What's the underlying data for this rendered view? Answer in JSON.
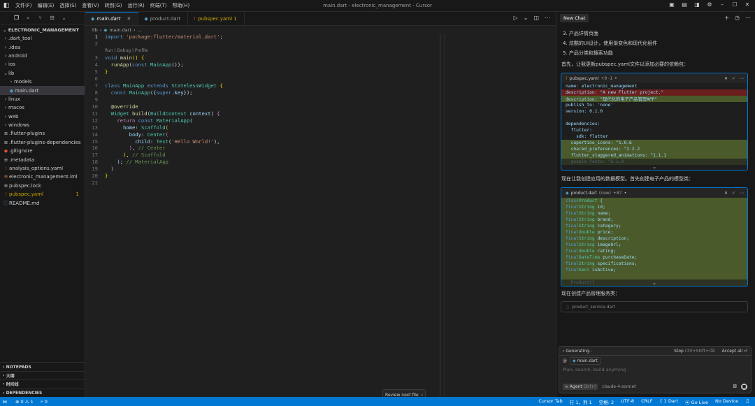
{
  "titlebar": {
    "menu": [
      "文件(F)",
      "编辑(E)",
      "选择(S)",
      "查看(V)",
      "转到(G)",
      "运行(R)",
      "终端(T)",
      "帮助(H)"
    ],
    "window_title": "main.dart - electronic_management - Cursor"
  },
  "explorer": {
    "project": "ELECTRONIC_MANAGEMENT",
    "items": [
      {
        "name": ".dart_tool",
        "type": "folder",
        "depth": 0
      },
      {
        "name": ".idea",
        "type": "folder",
        "depth": 0
      },
      {
        "name": "android",
        "type": "folder",
        "depth": 0
      },
      {
        "name": "ios",
        "type": "folder",
        "depth": 0
      },
      {
        "name": "lib",
        "type": "folder-open",
        "depth": 0
      },
      {
        "name": "models",
        "type": "folder",
        "depth": 1
      },
      {
        "name": "main.dart",
        "type": "dart",
        "depth": 1
      },
      {
        "name": "linux",
        "type": "folder",
        "depth": 0
      },
      {
        "name": "macos",
        "type": "folder",
        "depth": 0
      },
      {
        "name": "web",
        "type": "folder",
        "depth": 0
      },
      {
        "name": "windows",
        "type": "folder",
        "depth": 0
      },
      {
        "name": ".flutter-plugins",
        "type": "file",
        "depth": 0
      },
      {
        "name": ".flutter-plugins-dependencies",
        "type": "file",
        "depth": 0
      },
      {
        "name": ".gitignore",
        "type": "git",
        "depth": 0
      },
      {
        "name": ".metadata",
        "type": "file",
        "depth": 0
      },
      {
        "name": "analysis_options.yaml",
        "type": "yaml",
        "depth": 0
      },
      {
        "name": "electronic_management.iml",
        "type": "iml",
        "depth": 0
      },
      {
        "name": "pubspec.lock",
        "type": "file",
        "depth": 0
      },
      {
        "name": "pubspec.yaml",
        "type": "yaml-warn",
        "depth": 0,
        "badge": "1"
      },
      {
        "name": "README.md",
        "type": "info",
        "depth": 0
      }
    ],
    "panels": [
      "NOTEPADS",
      "大纲",
      "时间线",
      "DEPENDENCIES"
    ]
  },
  "editor": {
    "tabs": [
      {
        "label": "main.dart",
        "active": true
      },
      {
        "label": "product.dart",
        "active": false
      },
      {
        "label": "pubspec.yaml 1",
        "active": false,
        "warn": true
      }
    ],
    "breadcrumb": [
      "lib",
      "main.dart",
      "..."
    ],
    "codelens": "Run | Debug | Profile",
    "lines": [
      {
        "n": "1",
        "html": "<span class=\"k\">import</span> <span class=\"s\">'package:flutter/material.dart'</span>;"
      },
      {
        "n": "2",
        "html": ""
      },
      {
        "n": "3",
        "html": "<span class=\"k\">void</span> <span class=\"f\">main</span><span class=\"y\">()</span> <span class=\"y\">{</span>"
      },
      {
        "n": "4",
        "html": "  <span class=\"f\">runApp</span>(<span class=\"k\">const</span> <span class=\"t\">MainApp</span>());"
      },
      {
        "n": "5",
        "html": "<span class=\"y\">}</span>"
      },
      {
        "n": "6",
        "html": ""
      },
      {
        "n": "7",
        "html": "<span class=\"k\">class</span> <span class=\"t\">MainApp</span> <span class=\"k\">extends</span> <span class=\"t\">StatelessWidget</span> <span class=\"y\">{</span>"
      },
      {
        "n": "8",
        "html": "  <span class=\"k\">const</span> <span class=\"t\">MainApp</span>(<span class=\"p\">{</span><span class=\"k\">super</span>.<span class=\"p\">key</span><span class=\"p\">}</span>);"
      },
      {
        "n": "9",
        "html": ""
      },
      {
        "n": "10",
        "html": "  <span class=\"an\">@override</span>"
      },
      {
        "n": "11",
        "html": "  <span class=\"t\">Widget</span> <span class=\"f\">build</span>(<span class=\"t\">BuildContext</span> <span class=\"p\">context</span>) <span class=\"kw\">{</span>"
      },
      {
        "n": "12",
        "html": "    <span class=\"kw\">return</span> <span class=\"k\">const</span> <span class=\"t\">MaterialApp</span><span class=\"p\">(</span>"
      },
      {
        "n": "13",
        "html": "      <span class=\"p\">home</span>: <span class=\"t\">Scaffold</span><span class=\"y\">(</span>"
      },
      {
        "n": "14",
        "html": "        <span class=\"p\">body</span>: <span class=\"t\">Center</span><span class=\"kw\">(</span>"
      },
      {
        "n": "15",
        "html": "          <span class=\"p\">child</span>: <span class=\"t\">Text</span>(<span class=\"s\">'Hello World!'</span>),"
      },
      {
        "n": "16",
        "html": "        <span class=\"kw\">)</span>, <span class=\"c\">// Center</span>"
      },
      {
        "n": "17",
        "html": "      <span class=\"y\">)</span>, <span class=\"c\">// Scaffold</span>"
      },
      {
        "n": "18",
        "html": "    <span class=\"p\">)</span>; <span class=\"c\">// MaterialApp</span>"
      },
      {
        "n": "19",
        "html": "  <span class=\"kw\">}</span>"
      },
      {
        "n": "20",
        "html": "<span class=\"y\">}</span>"
      },
      {
        "n": "21",
        "html": ""
      }
    ],
    "review_label": "Review next file"
  },
  "chat": {
    "new_chat": "New Chat",
    "list_items": [
      "3. 产品详情页面",
      "4. 炫酷的UI设计，使用渐变色和现代化组件",
      "5. 产品分类和搜索功能"
    ],
    "para1": "首先，让我更新pubspec.yaml文件以添加必要的依赖包：",
    "block1": {
      "file": "pubspec.yaml",
      "diff": "+9 -1",
      "lines": [
        {
          "t": "name: electronic_management",
          "k": ""
        },
        {
          "t": "description: \"A new Flutter project.\"",
          "k": "del"
        },
        {
          "t": "description: \"现代化的电子产品管理APP\"",
          "k": "add"
        },
        {
          "t": "publish_to: 'none'",
          "k": ""
        },
        {
          "t": "version: 0.1.0",
          "k": ""
        },
        {
          "t": "",
          "k": ""
        },
        {
          "t": "dependencies:",
          "k": ""
        },
        {
          "t": "  flutter:",
          "k": ""
        },
        {
          "t": "    sdk: flutter",
          "k": ""
        },
        {
          "t": "  cupertino_icons: ^1.0.6",
          "k": "add"
        },
        {
          "t": "  shared_preferences: ^2.2.2",
          "k": "add"
        },
        {
          "t": "  flutter_staggered_animations: ^1.1.1",
          "k": "add"
        },
        {
          "t": "  google_fonts: ^6.1.0",
          "k": "add fade"
        }
      ]
    },
    "para2": "现在让我创建应用的数据模型。首先创建电子产品的模型类：",
    "block2": {
      "file": "product.dart",
      "tag": "(new)",
      "diff": "+87",
      "lines": [
        {
          "t": "class Product {",
          "k": "add"
        },
        {
          "t": "  final String id;",
          "k": "add"
        },
        {
          "t": "  final String name;",
          "k": "add"
        },
        {
          "t": "  final String brand;",
          "k": "add"
        },
        {
          "t": "  final String category;",
          "k": "add"
        },
        {
          "t": "  final double price;",
          "k": "add"
        },
        {
          "t": "  final String description;",
          "k": "add"
        },
        {
          "t": "  final String imageUrl;",
          "k": "add"
        },
        {
          "t": "  final double rating;",
          "k": "add"
        },
        {
          "t": "  final DateTime purchaseDate;",
          "k": "add"
        },
        {
          "t": "  final String specifications;",
          "k": "add"
        },
        {
          "t": "  final bool isActive;",
          "k": "add"
        },
        {
          "t": "",
          "k": "add"
        },
        {
          "t": "  Product({",
          "k": "add fade"
        }
      ]
    },
    "para3": "现在创建产品管理服务类：",
    "pending_file": "product_service.dart",
    "input": {
      "generating": "Generating..",
      "stop": "Stop",
      "stop_kbd": "Ctrl+Shift+⌫",
      "accept_all": "Accept all",
      "accept_kbd": "⏎",
      "context_file": "main.dart",
      "placeholder": "Plan, search, build anything",
      "mode": "Agent",
      "mode_kbd": "Ctrl+I",
      "model": "claude-4-sonnet"
    }
  },
  "statusbar": {
    "problems": "⊗ 0 ⚠ 1",
    "ports": "⑂ 0",
    "cursor_tab": "Cursor Tab",
    "position": "行 1，列 1",
    "spaces": "空格: 2",
    "encoding": "UTF-8",
    "eol": "CRLF",
    "lang": "{ } Dart",
    "golive": "⦿ Go Live",
    "device": "No Device"
  }
}
